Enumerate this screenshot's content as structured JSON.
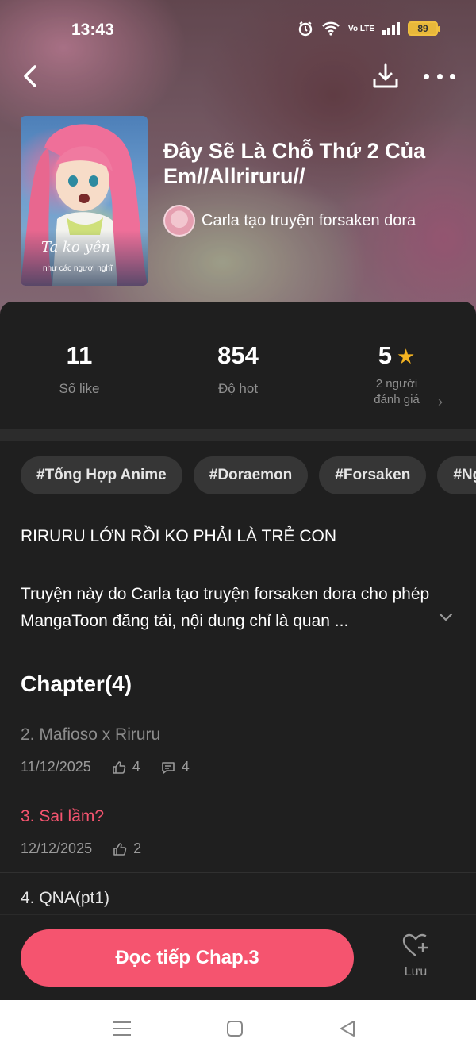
{
  "status_bar": {
    "time": "13:43",
    "battery": "89",
    "network": "Vo LTE"
  },
  "header": {
    "title": "Đây Sẽ Là Chỗ Thứ 2 Của Em//Allriruru//",
    "author": "Carla tạo truyện forsaken dora",
    "cover_text": "Ta ko yên",
    "cover_subtext": "như các ngươi nghĩ"
  },
  "stats": [
    {
      "value": "11",
      "label": "Số like"
    },
    {
      "value": "854",
      "label": "Độ hot"
    },
    {
      "value": "5",
      "label_line1": "2 người",
      "label_line2": "đánh giá"
    }
  ],
  "tags": [
    "#Tổng Hợp Anime",
    "#Doraemon",
    "#Forsaken",
    "#Ng"
  ],
  "description": {
    "headline": "RIRURU LỚN RỒI KO PHẢI LÀ TRẺ CON",
    "body": "Truyện này do Carla tạo truyện forsaken dora cho phép MangaToon đăng tải, nội dung chỉ là quan ..."
  },
  "chapters": {
    "heading": "Chapter(4)",
    "items": [
      {
        "name": "2. Mafioso x Riruru",
        "date": "11/12/2025",
        "likes": "4",
        "comments": "4",
        "state": "read"
      },
      {
        "name": "3. Sai lầm?",
        "date": "12/12/2025",
        "likes": "2",
        "state": "current"
      },
      {
        "name": "4. QNA(pt1)",
        "state": "unread"
      }
    ]
  },
  "actions": {
    "read_label": "Đọc tiếp Chap.3",
    "save_label": "Lưu"
  },
  "colors": {
    "accent": "#f5546f",
    "star": "#f4b321",
    "background": "#1f1f1f"
  },
  "icons": [
    "back-icon",
    "download-icon",
    "more-icon",
    "star-icon",
    "chevron-right-icon",
    "chevron-down-icon",
    "like-icon",
    "comment-icon",
    "heart-plus-icon",
    "menu-icon",
    "home-icon",
    "back-nav-icon"
  ]
}
